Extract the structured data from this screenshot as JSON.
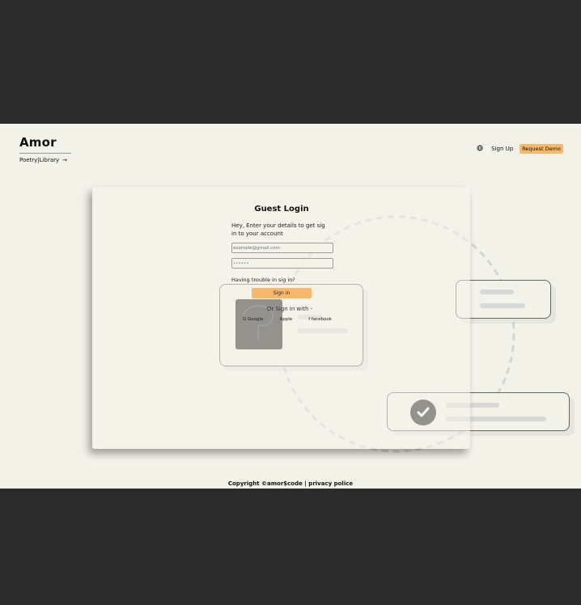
{
  "brand": {
    "title": "Amor",
    "subtitle": "Poetry|Library",
    "arrow": "→"
  },
  "topnav": {
    "signup_label": "Sign Up",
    "demo_label": "Request Demo",
    "globe_icon": "globe-icon"
  },
  "login": {
    "title": "Guest Login",
    "description": "Hey, Enter your details to get sig in to your account",
    "email_placeholder": "example@gmail.com",
    "password_value": "••••••",
    "trouble": "Having trouble in sig in?",
    "signin_label": "Sign in",
    "signin_with": "Or Sign in with -",
    "socials": [
      {
        "label": "Google",
        "icon": "G"
      },
      {
        "label": "Apple",
        "icon": ""
      },
      {
        "label": "facebook",
        "icon": "f"
      }
    ]
  },
  "footer": {
    "text": "Copyright ©amor$code | privacy police"
  },
  "colors": {
    "accent": "#f7b86b",
    "page_bg": "#f3f2e9",
    "frame_bg": "#2b2b2b"
  }
}
